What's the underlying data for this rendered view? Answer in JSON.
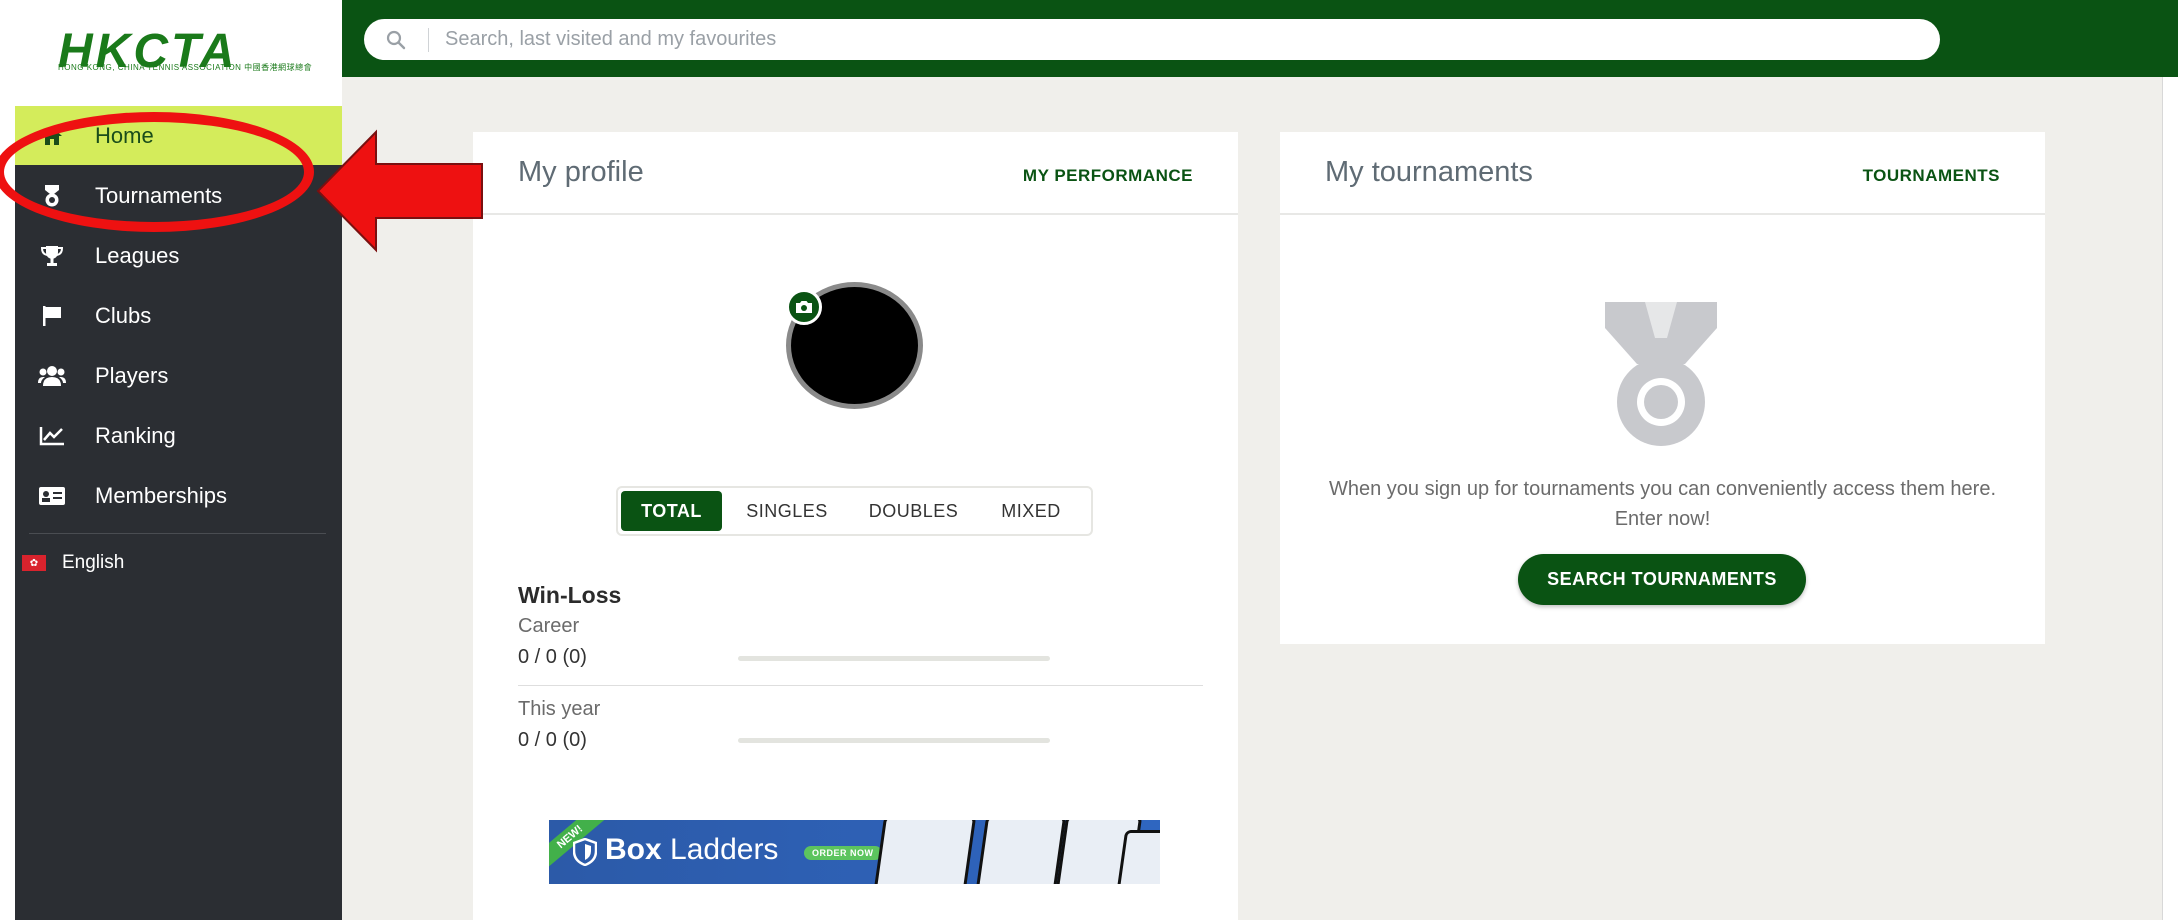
{
  "brand": {
    "logo_text": "HKCTA",
    "logo_sub": "HONG KONG, CHINA TENNIS ASSOCIATION 中國香港網球總會"
  },
  "search": {
    "placeholder": "Search, last visited and my favourites"
  },
  "sidebar": {
    "items": [
      {
        "label": "Home",
        "icon": "home-icon",
        "active": true
      },
      {
        "label": "Tournaments",
        "icon": "medal-icon"
      },
      {
        "label": "Leagues",
        "icon": "trophy-icon"
      },
      {
        "label": "Clubs",
        "icon": "flag-icon"
      },
      {
        "label": "Players",
        "icon": "users-icon"
      },
      {
        "label": "Ranking",
        "icon": "chart-line-icon"
      },
      {
        "label": "Memberships",
        "icon": "id-card-icon"
      }
    ],
    "language": "English"
  },
  "profile": {
    "title": "My profile",
    "link": "MY PERFORMANCE",
    "tabs": [
      "TOTAL",
      "SINGLES",
      "DOUBLES",
      "MIXED"
    ],
    "active_tab": "TOTAL",
    "winloss_title": "Win-Loss",
    "career_label": "Career",
    "career_value": "0 / 0 (0)",
    "year_label": "This year",
    "year_value": "0 / 0 (0)",
    "banner": {
      "ribbon": "NEW!",
      "title_bold": "Box",
      "title_rest": " Ladders",
      "cta": "ORDER NOW"
    }
  },
  "tournaments": {
    "title": "My tournaments",
    "link": "TOURNAMENTS",
    "empty_message": "When you sign up for tournaments you can conveniently access them here. Enter now!",
    "button": "SEARCH TOURNAMENTS"
  },
  "colors": {
    "brand_green": "#0a5313",
    "active_nav": "#d4ec5b",
    "sidebar": "#2b2e33",
    "annotation": "#ee1111"
  }
}
